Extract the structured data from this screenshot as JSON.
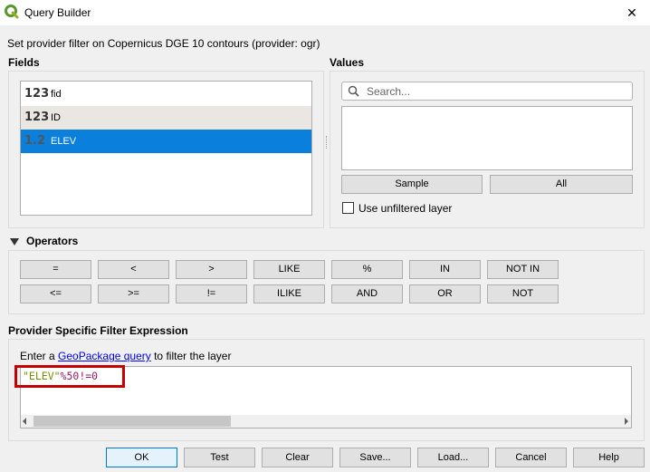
{
  "window": {
    "title": "Query Builder",
    "close_glyph": "✕",
    "app_icon": "qgis-logo-icon"
  },
  "description": "Set provider filter on Copernicus DGE 10 contours (provider: ogr)",
  "fields": {
    "label": "Fields",
    "items": [
      {
        "type": "123",
        "name": "fid"
      },
      {
        "type": "123",
        "name": "ID"
      },
      {
        "type": "1.2",
        "name": "ELEV"
      }
    ]
  },
  "values": {
    "label": "Values",
    "search_placeholder": "Search...",
    "sample_label": "Sample",
    "all_label": "All",
    "unfiltered_label": "Use unfiltered layer"
  },
  "operators": {
    "label": "Operators",
    "row1": [
      "=",
      "<",
      ">",
      "LIKE",
      "%",
      "IN",
      "NOT IN"
    ],
    "row2": [
      "<=",
      ">=",
      "!=",
      "ILIKE",
      "AND",
      "OR",
      "NOT"
    ]
  },
  "filter": {
    "label": "Provider Specific Filter Expression",
    "hint_prefix": "Enter a ",
    "hint_link": "GeoPackage query",
    "hint_suffix": " to filter the layer",
    "expr_field": "\"ELEV\"",
    "expr_rest": "%50!=0"
  },
  "footer": {
    "ok": "OK",
    "test": "Test",
    "clear": "Clear",
    "save": "Save...",
    "load": "Load...",
    "cancel": "Cancel",
    "help": "Help"
  },
  "colors": {
    "selection": "#0a7fdc",
    "expr_field": "#7a8c00",
    "expr_op": "#9b1a6a",
    "highlight_box": "#c40000"
  }
}
